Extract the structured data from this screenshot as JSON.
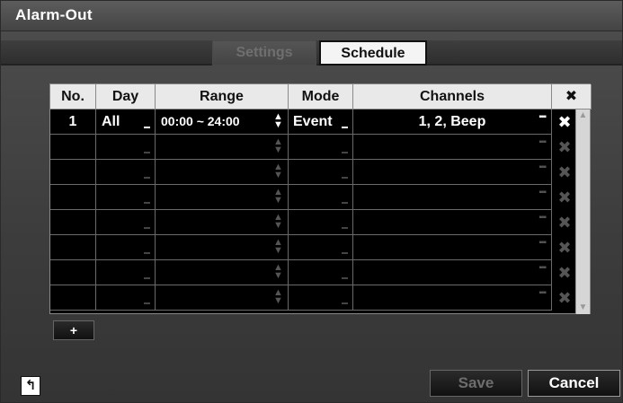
{
  "window": {
    "title": "Alarm-Out"
  },
  "tabs": [
    {
      "label": "Settings"
    },
    {
      "label": "Schedule"
    }
  ],
  "table": {
    "headers": [
      "No.",
      "Day",
      "Range",
      "Mode",
      "Channels"
    ],
    "delete_header_icon": "close-icon",
    "rows": [
      {
        "no": "1",
        "day": "All",
        "range": "00:00 ~ 24:00",
        "mode": "Event",
        "channels": "1, 2, Beep"
      },
      {
        "no": "",
        "day": "",
        "range": "",
        "mode": "",
        "channels": ""
      },
      {
        "no": "",
        "day": "",
        "range": "",
        "mode": "",
        "channels": ""
      },
      {
        "no": "",
        "day": "",
        "range": "",
        "mode": "",
        "channels": ""
      },
      {
        "no": "",
        "day": "",
        "range": "",
        "mode": "",
        "channels": ""
      },
      {
        "no": "",
        "day": "",
        "range": "",
        "mode": "",
        "channels": ""
      },
      {
        "no": "",
        "day": "",
        "range": "",
        "mode": "",
        "channels": ""
      },
      {
        "no": "",
        "day": "",
        "range": "",
        "mode": "",
        "channels": ""
      }
    ]
  },
  "buttons": {
    "add": "+",
    "save": "Save",
    "cancel": "Cancel"
  },
  "icons": {
    "back": "back-arrow-icon",
    "delete": "close-icon",
    "spinner": "up-down-spinner-icon",
    "dropdown": "dropdown-corner-icon",
    "more": "ellipsis-icon"
  }
}
